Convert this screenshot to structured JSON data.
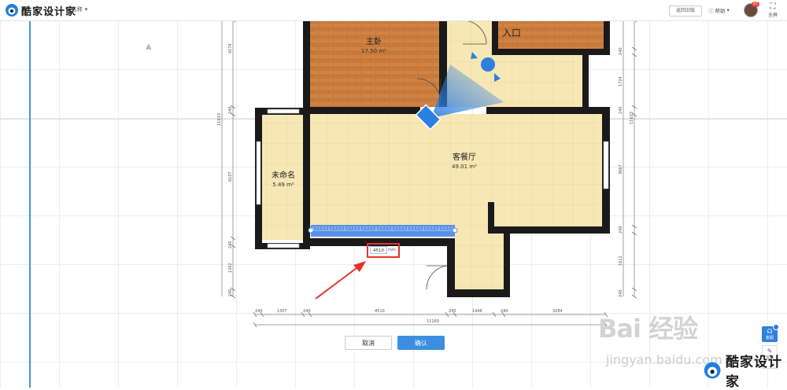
{
  "app": {
    "brand": "酷家设计家",
    "project_name": "名称"
  },
  "toolbar": {
    "back_label": "返回旧版",
    "help_label": "帮助",
    "avatar_badge": "37",
    "fullscreen_label": "全屏"
  },
  "rooms": [
    {
      "name": "主卧",
      "area": "17.50 m²"
    },
    {
      "name": "入口",
      "area": ""
    },
    {
      "name": "未命名",
      "area": "5.49 m²"
    },
    {
      "name": "客餐厅",
      "area": "49.01 m²"
    }
  ],
  "dimensions": {
    "left": [
      "4274",
      "240",
      "6107",
      "240",
      "1362",
      "240"
    ],
    "left_total": "11633",
    "right": [
      "240",
      "1724",
      "240",
      "3667",
      "240",
      "1612",
      "240"
    ],
    "right_total": "11633",
    "bottom": [
      "240",
      "1307",
      "240",
      "4510",
      "240",
      "1446",
      "240",
      "3284"
    ],
    "bottom_total": "11160"
  },
  "measure": {
    "value": "4510",
    "unit": "mm"
  },
  "dialog": {
    "cancel_label": "取消",
    "confirm_label": "确认"
  },
  "side_tools": {
    "service_label": "客服",
    "feedback_label": "反馈"
  },
  "watermark": {
    "baidu": "Bai 经验",
    "jingyan": "jingyan.baidu.com",
    "brand": "酷家设计家"
  },
  "colors": {
    "wall": "#1a1a1a",
    "wood": "#c87a3d",
    "tile": "#f7e7b5",
    "accent": "#3c8fe0",
    "highlight": "#e5312a"
  }
}
